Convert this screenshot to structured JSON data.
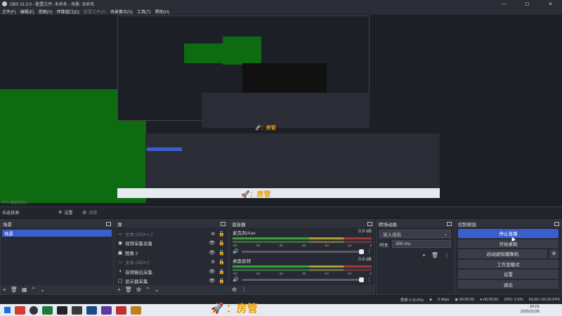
{
  "window": {
    "title": "OBS 31.0.0 - 配置文件: 未命名 - 场景: 未命名"
  },
  "menu": [
    {
      "label": "文件(F)",
      "disabled": false
    },
    {
      "label": "编辑(E)",
      "disabled": false
    },
    {
      "label": "视图(V)",
      "disabled": false
    },
    {
      "label": "停靠窗口(D)",
      "disabled": false
    },
    {
      "label": "配置文件(P)",
      "disabled": true
    },
    {
      "label": "场景集合(S)",
      "disabled": false
    },
    {
      "label": "工具(T)",
      "disabled": false
    },
    {
      "label": "帮助(H)",
      "disabled": false
    }
  ],
  "preview": {
    "overlay_text": "：房管",
    "zoom_readout": "57% 缩放查看(i)"
  },
  "source_toolbar": {
    "label": "未选择源",
    "properties": "设置",
    "filters": "滤镜"
  },
  "scenes": {
    "title": "场景",
    "items": [
      "场景"
    ]
  },
  "sources": {
    "title": "源",
    "items": [
      {
        "name": "文本 (GDI+) 2",
        "icon": "text-icon",
        "dim": true
      },
      {
        "name": "视频采集设备",
        "icon": "camera-icon",
        "dim": false
      },
      {
        "name": "图像 2",
        "icon": "image-icon",
        "dim": false
      },
      {
        "name": "文本 (GDI+)",
        "icon": "text-icon",
        "dim": true
      },
      {
        "name": "音频输出采集",
        "icon": "speaker-icon",
        "dim": false
      },
      {
        "name": "显示器采集",
        "icon": "monitor-icon",
        "dim": false
      }
    ]
  },
  "mixer": {
    "title": "混音器",
    "channels": [
      {
        "name": "麦克风/Aux",
        "db": "0.0 dB"
      },
      {
        "name": "桌面音频",
        "db": "0.0 dB"
      }
    ],
    "scale": [
      "-60",
      "-55",
      "-50",
      "-45",
      "-40",
      "-35",
      "-30",
      "-25",
      "-20",
      "-15",
      "-10",
      "-5",
      "0"
    ]
  },
  "transitions": {
    "title": "转场动画",
    "selected": "淡入淡出",
    "duration_label": "时长",
    "duration_value": "300 ms"
  },
  "controls": {
    "title": "控制按钮",
    "buttons": [
      "停止直播",
      "开始录制",
      "启动虚拟摄像机",
      "工作室模式",
      "设置",
      "退出"
    ]
  },
  "status": {
    "dropped": "丢帧 0 (0.0%)",
    "bitrate": "0 kbps",
    "stream_time": "00:00:00",
    "rec_time": "00:00:00",
    "cpu": "CPU: 0.6%",
    "fps": "60.00 / 60.00 FPS"
  },
  "taskbar": {
    "overlay_text": "：房管",
    "time": "20:01",
    "date": "2025/11/26"
  },
  "colors": {
    "accent": "#3a5fcd",
    "green": "#0f6b12",
    "overlay": "#e8a000"
  }
}
